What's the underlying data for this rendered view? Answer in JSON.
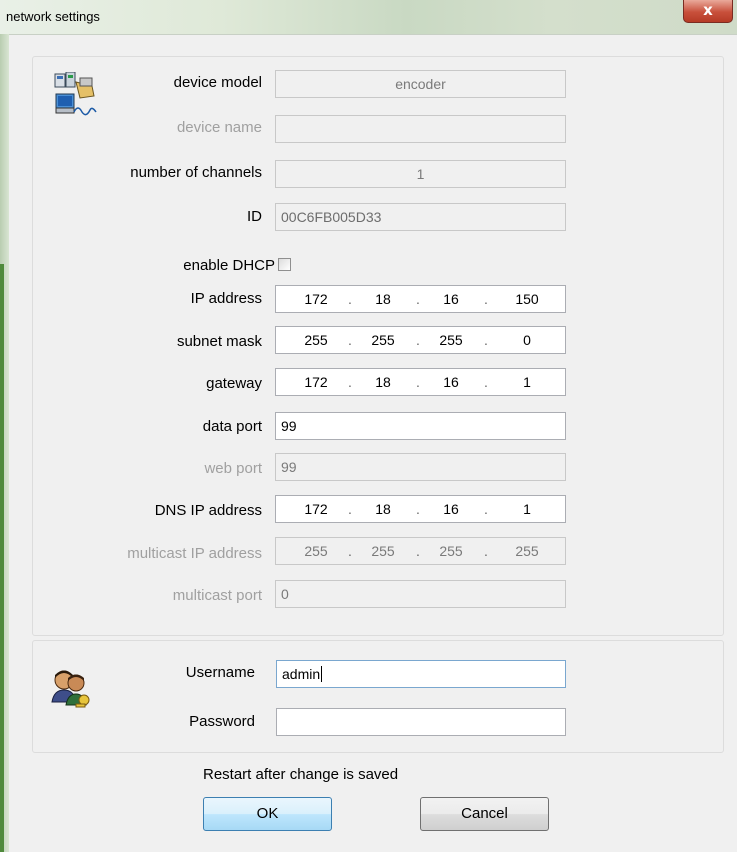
{
  "window": {
    "title": "network settings",
    "close_symbol": "x"
  },
  "device": {
    "model_label": "device model",
    "model_value": "encoder",
    "name_label": "device name",
    "name_value": "",
    "channels_label": "number of channels",
    "channels_value": "1",
    "id_label": "ID",
    "id_value": "00C6FB005D33",
    "dhcp_label": "enable DHCP",
    "dhcp_checked": false,
    "ip_label": "IP address",
    "ip": [
      "172",
      "18",
      "16",
      "150"
    ],
    "subnet_label": "subnet mask",
    "subnet": [
      "255",
      "255",
      "255",
      "0"
    ],
    "gateway_label": "gateway",
    "gateway": [
      "172",
      "18",
      "16",
      "1"
    ],
    "data_port_label": "data port",
    "data_port": "99",
    "web_port_label": "web port",
    "web_port": "99",
    "dns_label": "DNS IP address",
    "dns": [
      "172",
      "18",
      "16",
      "1"
    ],
    "mcast_label": "multicast IP address",
    "mcast": [
      "255",
      "255",
      "255",
      "255"
    ],
    "mcast_port_label": "multicast port",
    "mcast_port": "0",
    "ip_separator": "."
  },
  "auth": {
    "username_label": "Username",
    "username_value": "admin",
    "password_label": "Password",
    "password_value": ""
  },
  "footer": {
    "notice": "Restart after change is saved",
    "ok_label": "OK",
    "cancel_label": "Cancel"
  }
}
